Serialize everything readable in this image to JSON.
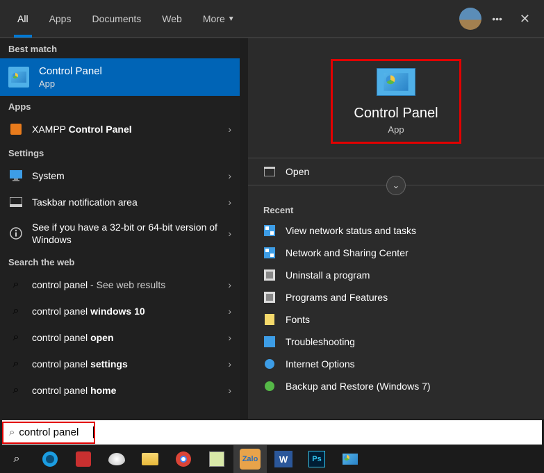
{
  "tabs": {
    "all": "All",
    "apps": "Apps",
    "documents": "Documents",
    "web": "Web",
    "more": "More"
  },
  "sections": {
    "best_match": "Best match",
    "apps": "Apps",
    "settings": "Settings",
    "search_web": "Search the web",
    "recent": "Recent"
  },
  "best_match_item": {
    "title": "Control Panel",
    "type": "App"
  },
  "apps_items": [
    {
      "prefix": "XAMPP ",
      "highlight": "Control Panel"
    }
  ],
  "settings_items": [
    {
      "label": "System"
    },
    {
      "label": "Taskbar notification area"
    },
    {
      "label": "See if you have a 32-bit or 64-bit version of Windows"
    }
  ],
  "web_items": [
    {
      "prefix": "control panel",
      "suffix": " - See web results",
      "suffix_plain": true
    },
    {
      "prefix": "control panel ",
      "highlight": "windows 10"
    },
    {
      "prefix": "control panel ",
      "highlight": "open"
    },
    {
      "prefix": "control panel ",
      "highlight": "settings"
    },
    {
      "prefix": "control panel ",
      "highlight": "home"
    }
  ],
  "preview": {
    "title": "Control Panel",
    "type": "App",
    "open": "Open"
  },
  "recent_items": [
    "View network status and tasks",
    "Network and Sharing Center",
    "Uninstall a program",
    "Programs and Features",
    "Fonts",
    "Troubleshooting",
    "Internet Options",
    "Backup and Restore (Windows 7)"
  ],
  "search": {
    "value": "control panel"
  }
}
